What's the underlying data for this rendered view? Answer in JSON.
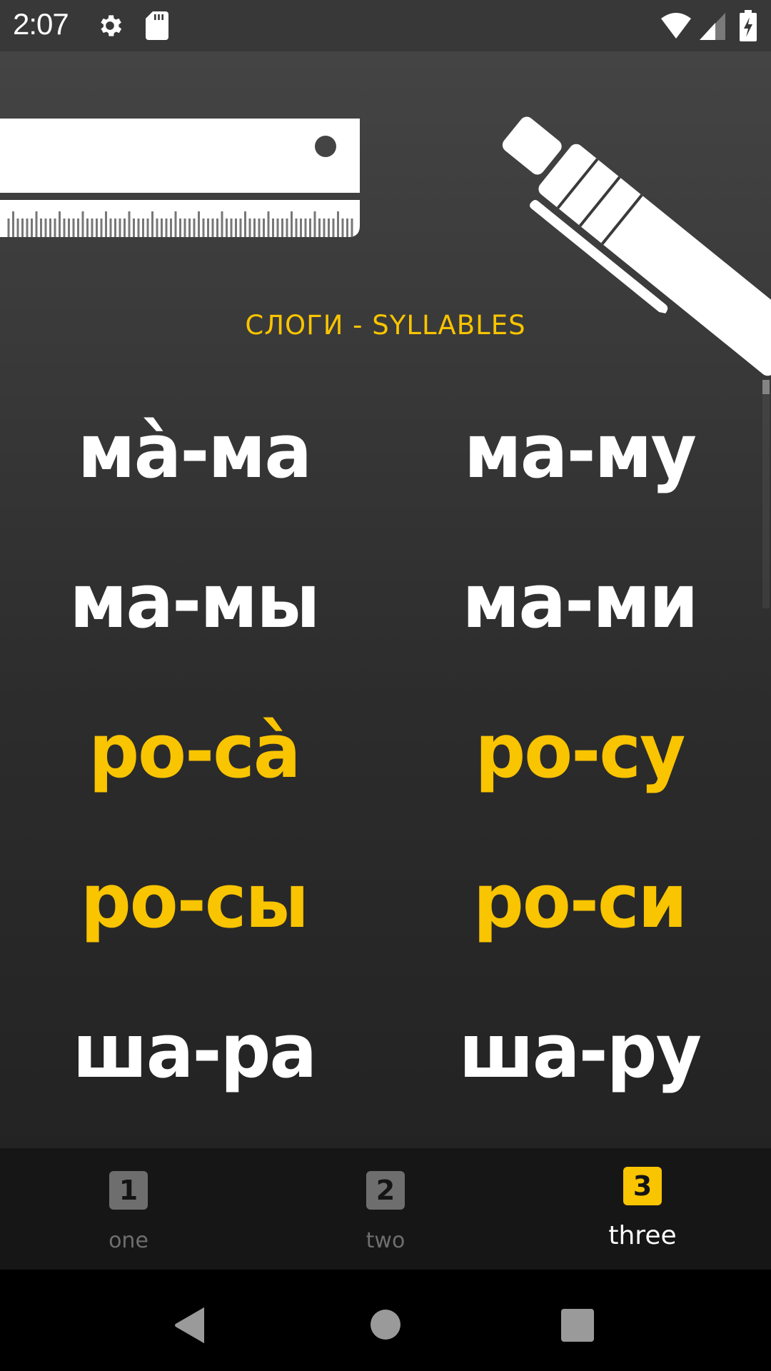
{
  "status_bar": {
    "time": "2:07",
    "left_icons": [
      "gear-icon",
      "sd-card-icon"
    ],
    "right_icons": [
      "wifi-icon",
      "cell-signal-icon",
      "battery-charging-icon"
    ]
  },
  "colors": {
    "accent": "#F9C400",
    "text_primary": "#FFFFFF",
    "inactive": "#6E6E6E",
    "nav_background": "#161616"
  },
  "header": {
    "illustrations": [
      "ruler-icon",
      "pen-icon"
    ],
    "title": "СЛОГИ - SYLLABLES"
  },
  "syllables": {
    "rows": [
      {
        "color": "white",
        "items": [
          "мà-ма",
          "ма-му"
        ]
      },
      {
        "color": "white",
        "items": [
          "ма-мы",
          "ма-ми"
        ]
      },
      {
        "color": "yellow",
        "items": [
          "ро-сà",
          "ро-су"
        ]
      },
      {
        "color": "yellow",
        "items": [
          "ро-сы",
          "ро-си"
        ]
      },
      {
        "color": "white",
        "items": [
          "ша-ра",
          "ша-ру"
        ]
      }
    ]
  },
  "bottom_nav": {
    "tabs": [
      {
        "badge": "1",
        "label": "one",
        "active": false
      },
      {
        "badge": "2",
        "label": "two",
        "active": false
      },
      {
        "badge": "3",
        "label": "three",
        "active": true
      }
    ]
  },
  "system_nav": {
    "buttons": [
      "back-icon",
      "home-icon",
      "recents-icon"
    ]
  }
}
